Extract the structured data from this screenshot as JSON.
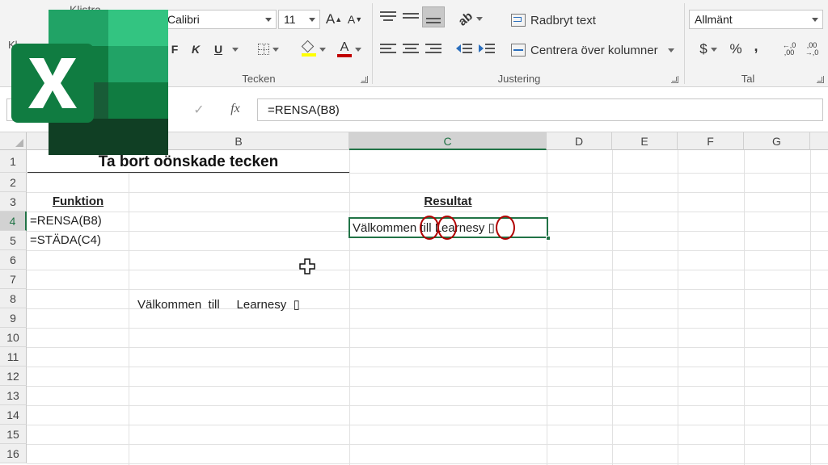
{
  "ribbon": {
    "clipboard": {
      "partial_label": "Kl",
      "partial_top": "Klistra"
    },
    "font": {
      "name": "Calibri",
      "size": "11",
      "grow": "A",
      "shrink": "A",
      "bold": "F",
      "italic": "K",
      "underline": "U",
      "font_color_glyph": "A",
      "group_label": "Tecken"
    },
    "alignment": {
      "wrap_text": "Radbryt text",
      "merge_center": "Centrera över kolumner",
      "group_label": "Justering"
    },
    "number": {
      "format": "Allmänt",
      "currency": "$",
      "percent": "%",
      "comma": ",",
      "group_label": "Tal"
    },
    "colors": {
      "font_color": "#c00000",
      "highlight": "#ffff00"
    }
  },
  "formula_bar": {
    "fx": "fx",
    "content": "=RENSA(B8)"
  },
  "grid": {
    "columns": [
      "B",
      "C",
      "D",
      "E",
      "F",
      "G"
    ],
    "selected_column": "C",
    "rows": [
      "1",
      "2",
      "3",
      "4",
      "5",
      "6",
      "7",
      "8",
      "9",
      "10",
      "11",
      "12",
      "13",
      "14",
      "15",
      "16"
    ],
    "selected_row": "4",
    "cells": {
      "title": "Ta bort oönskade tecken",
      "funktion_header": "Funktion",
      "f1": "=RENSA(B8)",
      "f2": "=STÄDA(C4)",
      "resultat_header": "Resultat",
      "result_value": "Välkommen till Learnesy ▯",
      "b8_value": "Välkommen  till     Learnesy  ▯"
    }
  },
  "brand": {
    "excel_green": "#217346",
    "annotation_red": "#b00000"
  },
  "icons": [
    "excel-logo-icon",
    "cell-cursor-icon"
  ]
}
